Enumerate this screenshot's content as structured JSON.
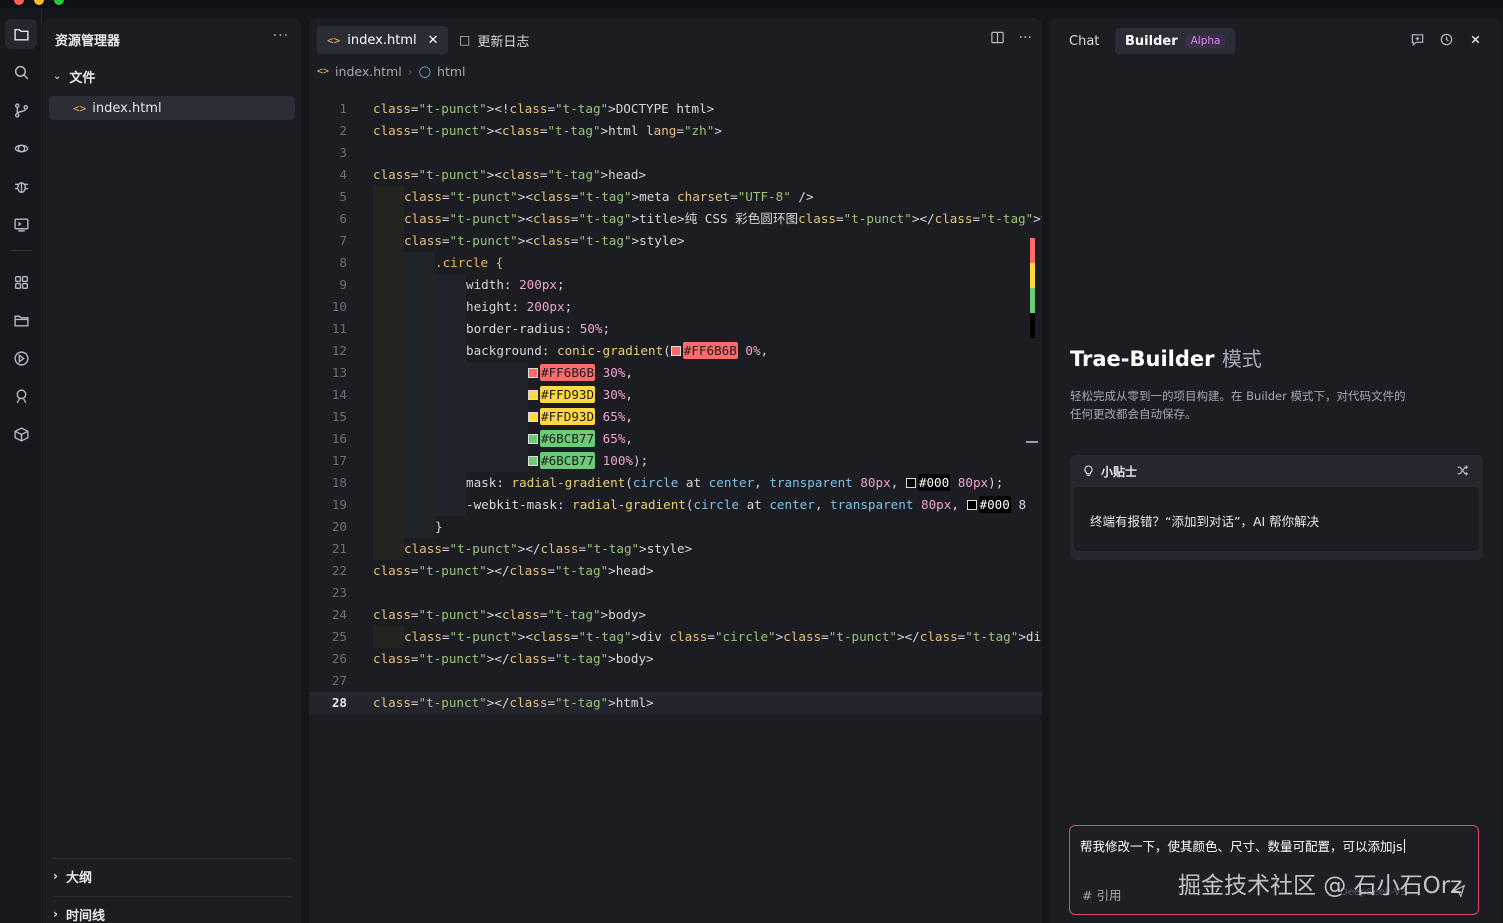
{
  "explorer": {
    "title": "资源管理器",
    "more": "···",
    "folder": "文件",
    "file": "index.html",
    "outline": "大纲",
    "timeline": "时间线"
  },
  "editor": {
    "active_tab": "index.html",
    "second_tab": "更新日志",
    "breadcrumb": [
      "index.html",
      "html"
    ],
    "current_line": 28,
    "lines": [
      "<!DOCTYPE html>",
      "<html lang=\"zh\">",
      "",
      "<head>",
      "<meta charset=\"UTF-8\" />",
      "<title>纯 CSS 彩色圆环图</title>",
      "<style>",
      ".circle {",
      "width: 200px;",
      "height: 200px;",
      "border-radius: 50%;",
      "background: conic-gradient(#FF6B6B 0%,",
      "#FF6B6B 30%,",
      "#FFD93D 30%,",
      "#FFD93D 65%,",
      "#6BCB77 65%,",
      "#6BCB77 100%);",
      "mask: radial-gradient(circle at center, transparent 80px, #000 80px);",
      "-webkit-mask: radial-gradient(circle at center, transparent 80px, #000 8",
      "}",
      "</style>",
      "</head>",
      "",
      "<body>",
      "<div class=\"circle\"></div>",
      "</body>",
      "",
      "</html>"
    ]
  },
  "colors": {
    "red": "#FF6B6B",
    "yellow": "#FFD93D",
    "green": "#6BCB77",
    "black": "#000",
    "input_border": "#e04a5f"
  },
  "panel": {
    "tab_chat": "Chat",
    "tab_builder": "Builder",
    "badge": "Alpha",
    "title": "Trae-Builder",
    "title_mode": "模式",
    "description": "轻松完成从零到一的项目构建。在 Builder 模式下，对代码文件的任何更改都会自动保存。",
    "tips_title": "小贴士",
    "tip": "终端有报错？“添加到对话”，AI 帮你解决",
    "input_value": "帮我修改一下，使其颜色、尺寸、数量可配置，可以添加js",
    "reference": "# 引用",
    "model": "DeepSeek-V3"
  },
  "watermark": "掘金技术社区 @ 石小石Orz"
}
